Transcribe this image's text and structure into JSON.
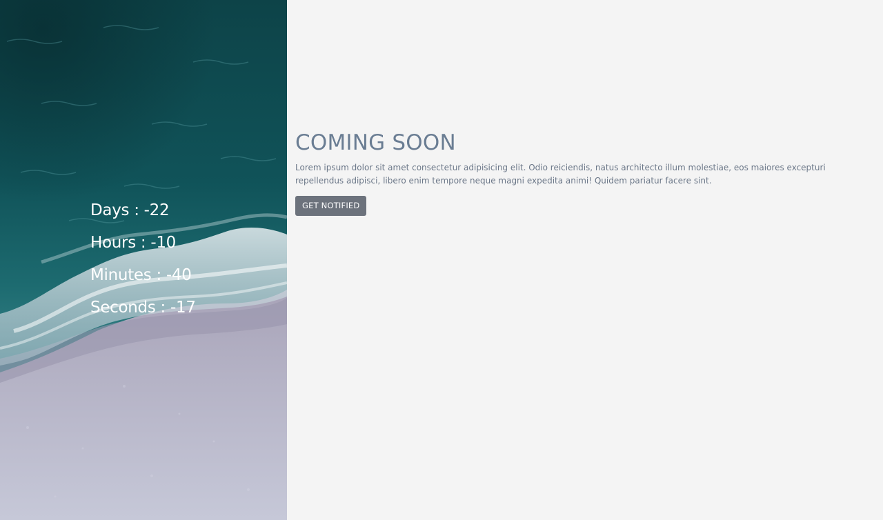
{
  "countdown": {
    "days": "Days : -22",
    "hours": "Hours : -10",
    "minutes": "Minutes : -40",
    "seconds": "Seconds : -17"
  },
  "main": {
    "title": "COMING SOON",
    "description": "Lorem ipsum dolor sit amet consectetur adipisicing elit. Odio reiciendis, natus architecto illum molestiae, eos maiores excepturi repellendus adipisci, libero enim tempore neque magni expedita animi! Quidem pariatur facere sint.",
    "button_label": "GET NOTIFIED"
  },
  "colors": {
    "background": "#f4f4f4",
    "title": "#6a7d93",
    "body_text": "#6b7788",
    "button_bg": "#6c727c",
    "button_text": "#ffffff",
    "ocean_deep": "#0f4a4e",
    "sand": "#b7b6c9"
  }
}
